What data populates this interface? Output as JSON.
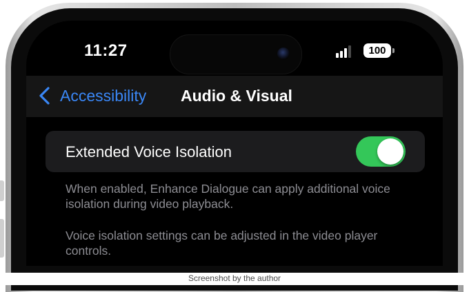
{
  "status_bar": {
    "time": "11:27",
    "battery": "100",
    "signal_bars_active": 3,
    "signal_bars_total": 4
  },
  "nav": {
    "back_label": "Accessibility",
    "title": "Audio & Visual"
  },
  "setting": {
    "label": "Extended Voice Isolation",
    "toggle_on": true,
    "toggle_color": "#34c759"
  },
  "footer": {
    "line1": "When enabled, Enhance Dialogue can apply additional voice isolation during video playback.",
    "line2": "Voice isolation settings can be adjusted in the video player controls."
  },
  "caption": "Screenshot by the author",
  "colors": {
    "accent_blue": "#3a87f6",
    "footer_gray": "#8d8d93"
  },
  "icons": [
    "chevron-left-icon",
    "signal-icon",
    "battery-icon",
    "camera-icon"
  ]
}
